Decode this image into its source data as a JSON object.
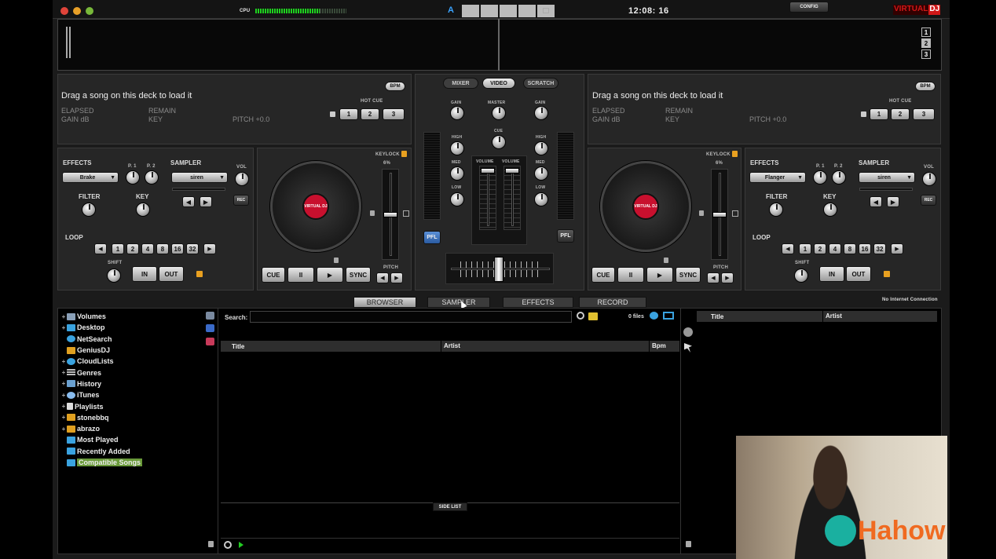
{
  "topbar": {
    "cpu_label": "CPU",
    "deck_letter": "A",
    "clock": "12:08: 16",
    "config": "CONFIG",
    "brand_a": "VIRTUAL",
    "brand_b": "DJ"
  },
  "waveform": {
    "pages": [
      "1",
      "2",
      "3"
    ]
  },
  "decks": {
    "left": {
      "title": "Drag a song on this deck to load it",
      "bpm": "BPM",
      "elapsed": "ELAPSED",
      "remain": "REMAIN",
      "gain": "GAIN dB",
      "key": "KEY",
      "pitch": "PITCH +0.0",
      "hot_cue": "HOT CUE",
      "hot_cues": [
        "1",
        "2",
        "3"
      ],
      "effects": "EFFECTS",
      "effect_value": "Brake",
      "p1": "P. 1",
      "p2": "P. 2",
      "sampler": "SAMPLER",
      "sampler_value": "siren",
      "vol": "VOL",
      "rec": "REC",
      "filter": "FILTER",
      "key_knob": "KEY",
      "loop": "LOOP",
      "loops": [
        "1",
        "2",
        "4",
        "8",
        "16",
        "32"
      ],
      "shift": "SHIFT",
      "in": "IN",
      "out": "OUT",
      "keylock": "KEYLOCK",
      "pct": "6%",
      "pitch_label": "PITCH",
      "cue": "CUE",
      "pause": "II",
      "play": "▶",
      "sync": "SYNC",
      "platter_brand": "VIRTUAL DJ"
    },
    "right": {
      "title": "Drag a song on this deck to load it",
      "bpm": "BPM",
      "elapsed": "ELAPSED",
      "remain": "REMAIN",
      "gain": "GAIN dB",
      "key": "KEY",
      "pitch": "PITCH +0.0",
      "hot_cue": "HOT CUE",
      "hot_cues": [
        "1",
        "2",
        "3"
      ],
      "effects": "EFFECTS",
      "effect_value": "Flanger",
      "p1": "P. 1",
      "p2": "P. 2",
      "sampler": "SAMPLER",
      "sampler_value": "siren",
      "vol": "VOL",
      "rec": "REC",
      "filter": "FILTER",
      "key_knob": "KEY",
      "loop": "LOOP",
      "loops": [
        "1",
        "2",
        "4",
        "8",
        "16",
        "32"
      ],
      "shift": "SHIFT",
      "in": "IN",
      "out": "OUT",
      "keylock": "KEYLOCK",
      "pct": "6%",
      "pitch_label": "PITCH",
      "cue": "CUE",
      "pause": "II",
      "play": "▶",
      "sync": "SYNC",
      "platter_brand": "VIRTUAL DJ"
    }
  },
  "mixer": {
    "tabs": [
      "MIXER",
      "VIDEO",
      "SCRATCH"
    ],
    "gain": "GAIN",
    "master": "MASTER",
    "cue": "CUE",
    "high": "HIGH",
    "med": "MED",
    "low": "LOW",
    "volume": "VOLUME",
    "pfl": "PFL"
  },
  "browser_tabs": [
    "BROWSER",
    "SAMPLER",
    "EFFECTS",
    "RECORD"
  ],
  "no_internet": "No Internet Connection",
  "tree": [
    {
      "label": "Volumes",
      "plus": "+",
      "color": "#8aa0b8"
    },
    {
      "label": "Desktop",
      "plus": "+",
      "color": "#3aa3e0"
    },
    {
      "label": "NetSearch",
      "plus": "",
      "color": "#3aa3e0"
    },
    {
      "label": "GeniusDJ",
      "plus": "",
      "color": "#e0a020"
    },
    {
      "label": "CloudLists",
      "plus": "+",
      "color": "#3aa3e0"
    },
    {
      "label": "Genres",
      "plus": "+",
      "color": "#bbbbbb"
    },
    {
      "label": "History",
      "plus": "+",
      "color": "#6aa0d0"
    },
    {
      "label": "iTunes",
      "plus": "+",
      "color": "#88bbee"
    },
    {
      "label": "Playlists",
      "plus": "+",
      "color": "#dddddd"
    },
    {
      "label": "stonebbq",
      "plus": "+",
      "color": "#e0a020"
    },
    {
      "label": "abrazo",
      "plus": "+",
      "color": "#e0a020"
    },
    {
      "label": "Most Played",
      "plus": "",
      "color": "#3aa3e0"
    },
    {
      "label": "Recently Added",
      "plus": "",
      "color": "#3aa3e0"
    },
    {
      "label": "Compatible Songs",
      "plus": "",
      "color": "#3aa3e0"
    }
  ],
  "search": {
    "label": "Search:",
    "count": "0 files"
  },
  "file_columns": {
    "title": "Title",
    "artist": "Artist",
    "bpm": "Bpm"
  },
  "side_columns": {
    "title": "Title",
    "artist": "Artist"
  },
  "side_list": "SIDE LIST",
  "watermark": "Hahow"
}
